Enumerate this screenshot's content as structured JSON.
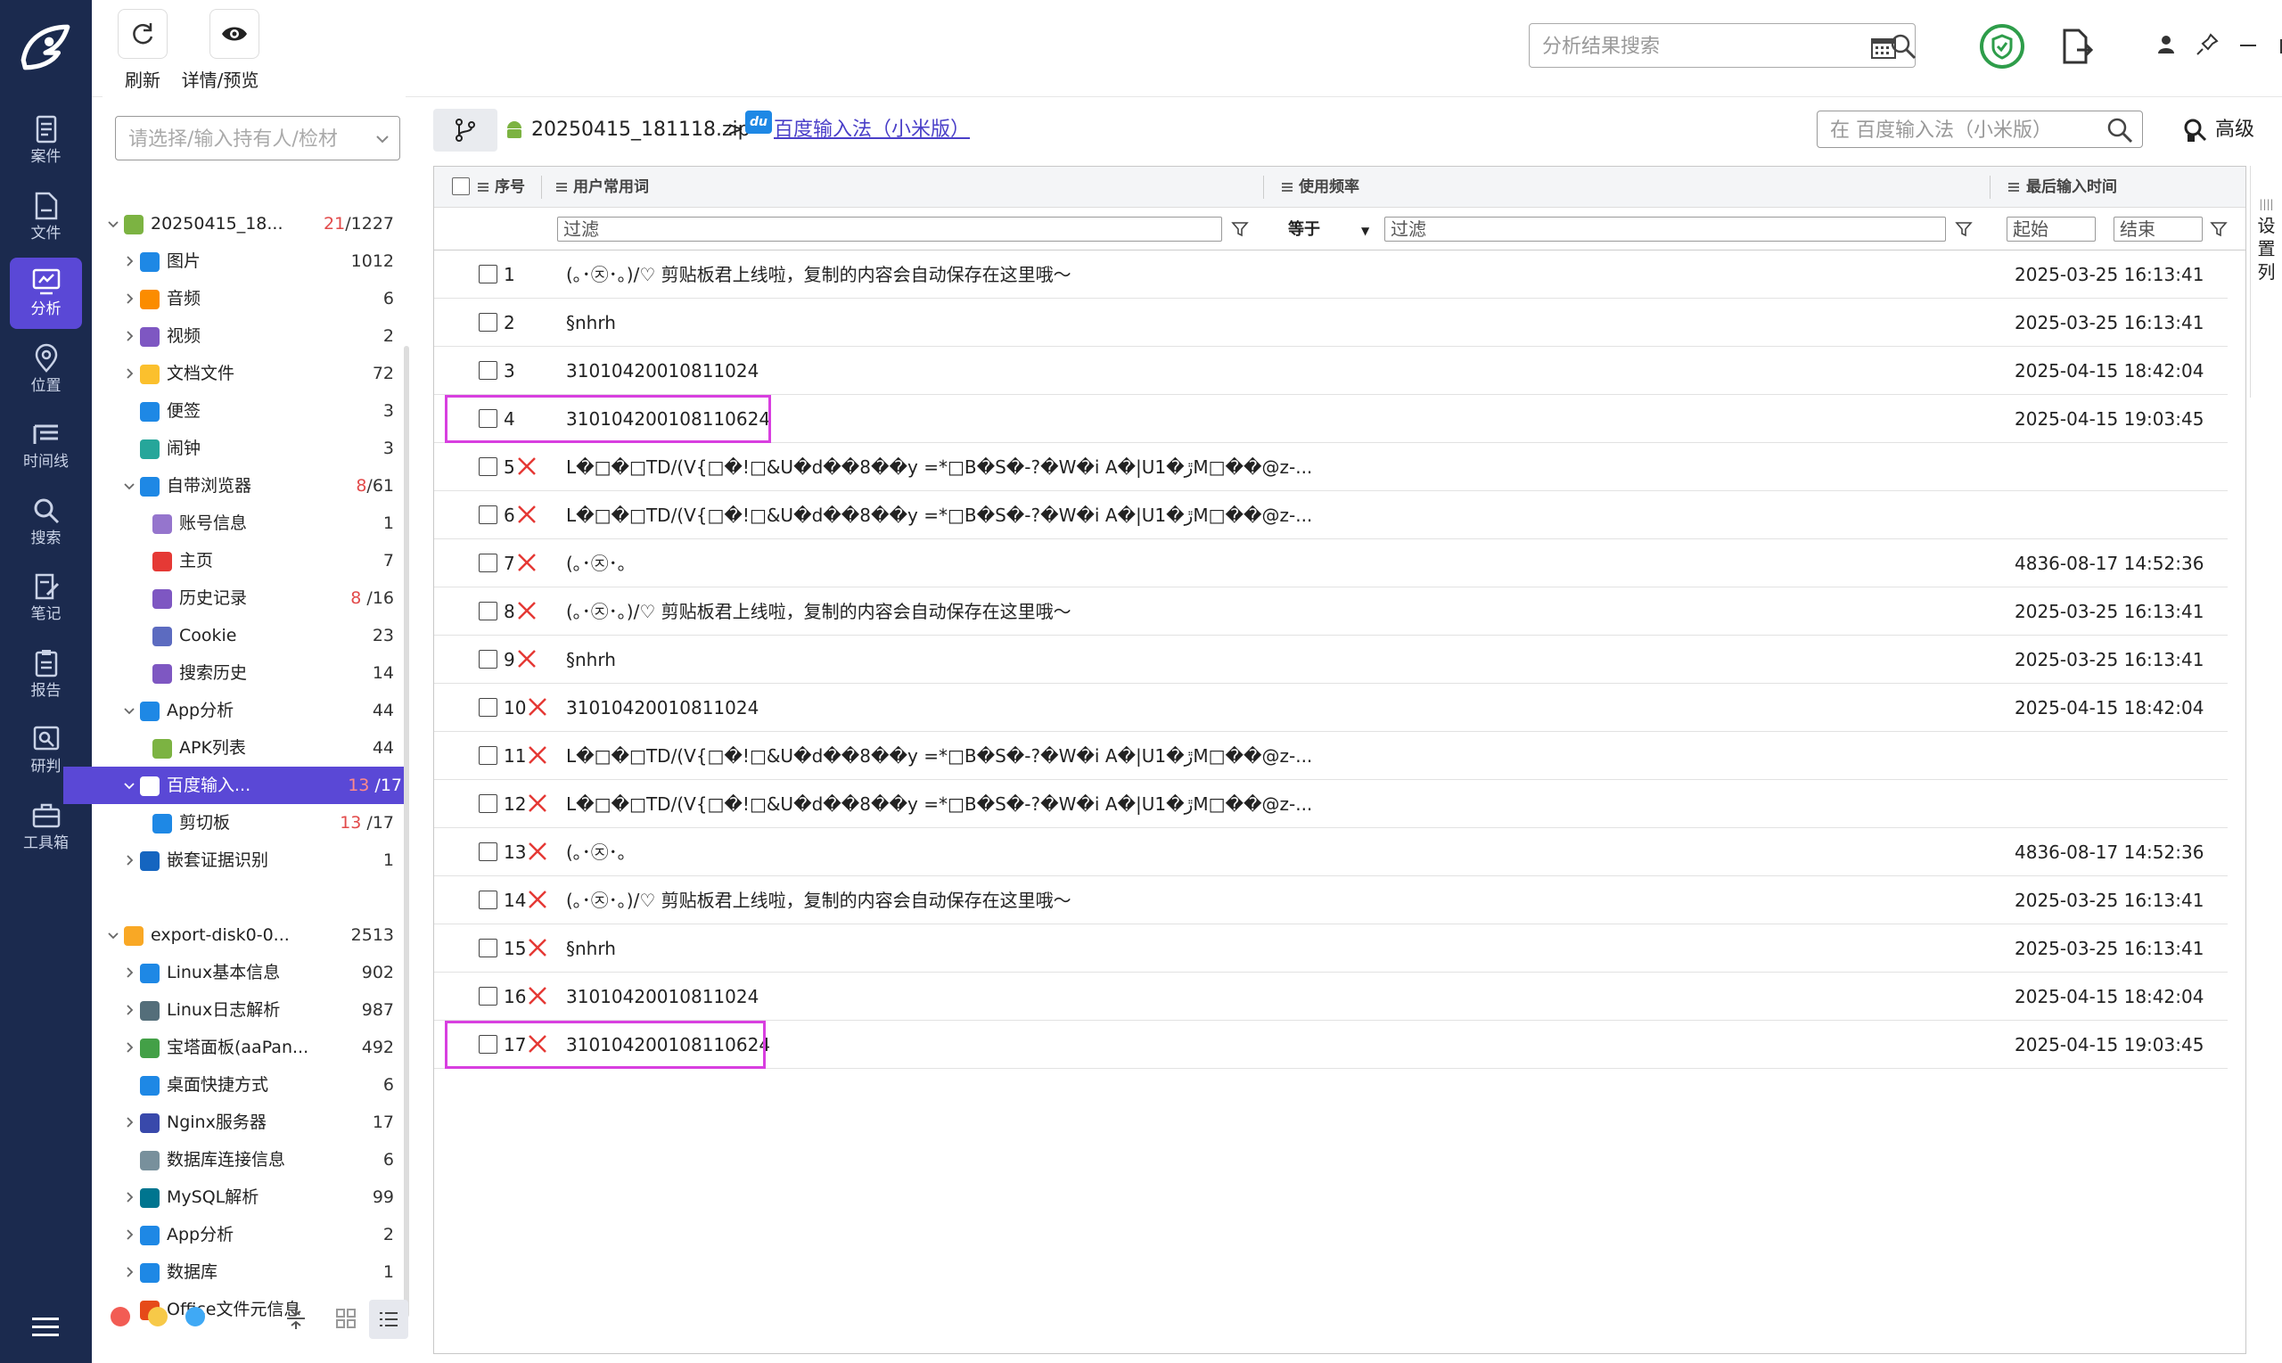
{
  "nav": {
    "items": [
      {
        "label": "案件",
        "icon": "case-icon"
      },
      {
        "label": "文件",
        "icon": "file-icon"
      },
      {
        "label": "分析",
        "icon": "analysis-icon"
      },
      {
        "label": "位置",
        "icon": "location-icon"
      },
      {
        "label": "时间线",
        "icon": "timeline-icon"
      },
      {
        "label": "搜索",
        "icon": "search-icon"
      },
      {
        "label": "笔记",
        "icon": "note-icon"
      },
      {
        "label": "报告",
        "icon": "report-icon"
      },
      {
        "label": "研判",
        "icon": "judge-icon"
      },
      {
        "label": "工具箱",
        "icon": "toolbox-icon"
      }
    ],
    "active_index": 2
  },
  "toolbar": {
    "refresh_label": "刷新",
    "detail_label": "详情/预览",
    "search_placeholder": "分析结果搜索"
  },
  "tree": {
    "case_placeholder": "请选择/输入持有人/检材",
    "rows": [
      {
        "label": "20250415_18...",
        "count_red": "21",
        "count": "/1227",
        "level": 0,
        "icon": "android-icon",
        "expanded": true
      },
      {
        "label": "图片",
        "count": "1012",
        "level": 1,
        "icon": "image-icon",
        "chev": true
      },
      {
        "label": "音频",
        "count": "6",
        "level": 1,
        "icon": "audio-icon",
        "chev": true
      },
      {
        "label": "视频",
        "count": "2",
        "level": 1,
        "icon": "video-icon",
        "chev": true
      },
      {
        "label": "文档文件",
        "count": "72",
        "level": 1,
        "icon": "document-icon",
        "chev": true
      },
      {
        "label": "便签",
        "count": "3",
        "level": 1,
        "icon": "memo-icon"
      },
      {
        "label": "闹钟",
        "count": "3",
        "level": 1,
        "icon": "alarm-icon"
      },
      {
        "label": "自带浏览器",
        "count_red": "8",
        "count": "/61",
        "level": 1,
        "icon": "browser-icon",
        "expanded": true
      },
      {
        "label": "账号信息",
        "count": "1",
        "level": 2,
        "icon": "account-icon"
      },
      {
        "label": "主页",
        "count": "7",
        "level": 2,
        "icon": "home-icon"
      },
      {
        "label": "历史记录",
        "count_red": "8",
        "count": " /16",
        "level": 2,
        "icon": "history-icon"
      },
      {
        "label": "Cookie",
        "count": "23",
        "level": 2,
        "icon": "cookie-icon"
      },
      {
        "label": "搜索历史",
        "count": "14",
        "level": 2,
        "icon": "search-history-icon"
      },
      {
        "label": "App分析",
        "count": "44",
        "level": 1,
        "icon": "app-analysis-icon",
        "expanded": true
      },
      {
        "label": "APK列表",
        "count": "44",
        "level": 2,
        "icon": "apk-icon"
      },
      {
        "label": "百度输入...",
        "count_red": "13",
        "count": " /17",
        "level": 1,
        "icon": "baidu-ime-icon",
        "expanded": true,
        "selected": true
      },
      {
        "label": "剪切板",
        "count_red": "13",
        "count": " /17",
        "level": 2,
        "icon": "clipboard-icon"
      },
      {
        "label": "嵌套证据识别",
        "count": "1",
        "level": 1,
        "icon": "nested-evidence-icon",
        "chev": true
      },
      {
        "label": "",
        "count": "",
        "level": 0,
        "spacer": true
      },
      {
        "label": "export-disk0-0...",
        "count": "2513",
        "level": 0,
        "icon": "linux-icon",
        "expanded": true
      },
      {
        "label": "Linux基本信息",
        "count": "902",
        "level": 1,
        "icon": "linux-info-icon",
        "chev": true
      },
      {
        "label": "Linux日志解析",
        "count": "987",
        "level": 1,
        "icon": "log-icon",
        "chev": true
      },
      {
        "label": "宝塔面板(aaPan...",
        "count": "492",
        "level": 1,
        "icon": "bt-panel-icon",
        "chev": true
      },
      {
        "label": "桌面快捷方式",
        "count": "6",
        "level": 1,
        "icon": "shortcut-icon"
      },
      {
        "label": "Nginx服务器",
        "count": "17",
        "level": 1,
        "icon": "nginx-icon",
        "chev": true
      },
      {
        "label": "数据库连接信息",
        "count": "6",
        "level": 1,
        "icon": "db-connection-icon"
      },
      {
        "label": "MySQL解析",
        "count": "99",
        "level": 1,
        "icon": "mysql-icon",
        "chev": true
      },
      {
        "label": "App分析",
        "count": "2",
        "level": 1,
        "icon": "app-analysis-icon",
        "chev": true
      },
      {
        "label": "数据库",
        "count": "1",
        "level": 1,
        "icon": "database-icon",
        "chev": true
      },
      {
        "label": "Office文件元信息",
        "count": "1",
        "level": 1,
        "icon": "office-icon"
      }
    ]
  },
  "breadcrumb": {
    "zip": "20250415_181118.zip",
    "sep": ">",
    "app": "百度输入法（小米版）"
  },
  "inner_search_placeholder": "在 百度输入法（小米版）",
  "advanced_label": "高级",
  "grid": {
    "columns": {
      "index": "序号",
      "word": "用户常用词",
      "freq": "使用频率",
      "time": "最后输入时间"
    },
    "filter_placeholder": "过滤",
    "op": "等于",
    "start": "起始",
    "end": "结束",
    "settings": "设置列",
    "rows": [
      {
        "n": "1",
        "deleted": false,
        "word": "(｡･㉨･｡)/♡  剪贴板君上线啦，复制的内容会自动保存在这里哦～",
        "time": "2025-03-25 16:13:41"
      },
      {
        "n": "2",
        "deleted": false,
        "word": "§nhrh",
        "time": "2025-03-25 16:13:41"
      },
      {
        "n": "3",
        "deleted": false,
        "word": "31010420010811024",
        "time": "2025-04-15 18:42:04"
      },
      {
        "n": "4",
        "deleted": false,
        "word": "310104200108110624",
        "time": "2025-04-15 19:03:45",
        "highlight": true
      },
      {
        "n": "5",
        "deleted": true,
        "word": "L�□�□TD/(V{□�!□&U�d��8��y =*□B�S�-?�W�i A�|U1�ڙM□��@z-...",
        "time": ""
      },
      {
        "n": "6",
        "deleted": true,
        "word": "L�□�□TD/(V{□�!□&U�d��8��y =*□B�S�-?�W�i A�|U1�ڙM□��@z-...",
        "time": ""
      },
      {
        "n": "7",
        "deleted": true,
        "word": "(｡･㉨･｡",
        "time": "4836-08-17 14:52:36"
      },
      {
        "n": "8",
        "deleted": true,
        "word": "(｡･㉨･｡)/♡  剪贴板君上线啦，复制的内容会自动保存在这里哦～",
        "time": "2025-03-25 16:13:41"
      },
      {
        "n": "9",
        "deleted": true,
        "word": "§nhrh",
        "time": "2025-03-25 16:13:41"
      },
      {
        "n": "10",
        "deleted": true,
        "word": "31010420010811024",
        "time": "2025-04-15 18:42:04"
      },
      {
        "n": "11",
        "deleted": true,
        "word": "L�□�□TD/(V{□�!□&U�d��8��y =*□B�S�-?�W�i A�|U1�ڙM□��@z-...",
        "time": ""
      },
      {
        "n": "12",
        "deleted": true,
        "word": "L�□�□TD/(V{□�!□&U�d��8��y =*□B�S�-?�W�i A�|U1�ڙM□��@z-...",
        "time": ""
      },
      {
        "n": "13",
        "deleted": true,
        "word": "(｡･㉨･｡",
        "time": "4836-08-17 14:52:36"
      },
      {
        "n": "14",
        "deleted": true,
        "word": "(｡･㉨･｡)/♡  剪贴板君上线啦，复制的内容会自动保存在这里哦～",
        "time": "2025-03-25 16:13:41"
      },
      {
        "n": "15",
        "deleted": true,
        "word": "§nhrh",
        "time": "2025-03-25 16:13:41"
      },
      {
        "n": "16",
        "deleted": true,
        "word": "31010420010811024",
        "time": "2025-04-15 18:42:04"
      },
      {
        "n": "17",
        "deleted": true,
        "word": "310104200108110624",
        "time": "2025-04-15 19:03:45",
        "highlight": true
      }
    ]
  },
  "colors": {
    "nav_bg": "#1b2a4e",
    "accent": "#5a48d6",
    "deleted_mark": "#e53935",
    "highlight_box": "#d83fe0",
    "shield_green": "#2e9d4a"
  }
}
